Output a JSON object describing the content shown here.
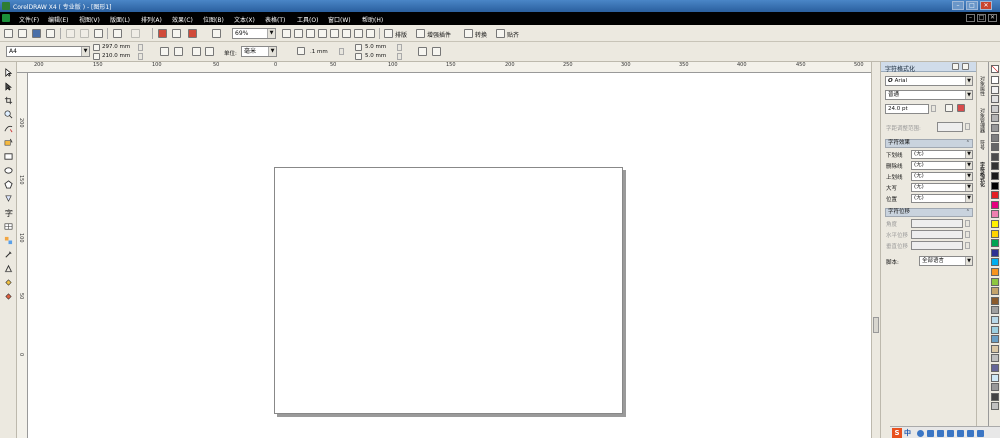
{
  "window": {
    "title": "CorelDRAW X4 ( 专业版 ) - [图形1]",
    "buttons": [
      "–",
      "□",
      "✕"
    ]
  },
  "menu": {
    "items": [
      "文件(F)",
      "编辑(E)",
      "视图(V)",
      "版面(L)",
      "排列(A)",
      "效果(C)",
      "位图(B)",
      "文本(X)",
      "表格(T)",
      "工具(O)",
      "窗口(W)",
      "帮助(H)"
    ]
  },
  "toolbar": {
    "zoom": "69%",
    "buttons": [
      "排版",
      "增强插件",
      "转换",
      "贴齐"
    ]
  },
  "propbar": {
    "paper": "A4",
    "width": "297.0 mm",
    "height": "210.0 mm",
    "unit_label": "单位:",
    "unit": "毫米",
    "nudge": ".1 mm",
    "dup_x": "5.0 mm",
    "dup_y": "5.0 mm"
  },
  "ruler": {
    "top_labels": [
      "200",
      "150",
      "100",
      "50",
      "0",
      "50",
      "100",
      "150",
      "200",
      "250",
      "300",
      "350",
      "400",
      "450",
      "500"
    ],
    "side_labels": [
      "200",
      "150",
      "100",
      "50",
      "0"
    ]
  },
  "docker": {
    "title": "字符格式化",
    "font": "Arial",
    "style": "普通",
    "size": "24.0 pt",
    "kerning_label": "字距调整范围:",
    "effects_header": "字符效果",
    "effects": [
      {
        "label": "下划线",
        "value": "(无)"
      },
      {
        "label": "删除线",
        "value": "(无)"
      },
      {
        "label": "上划线",
        "value": "(无)"
      },
      {
        "label": "大写",
        "value": "(无)"
      },
      {
        "label": "位置",
        "value": "(无)"
      }
    ],
    "shift_header": "字符位移",
    "shift": [
      "角度",
      "水平位移",
      "垂直位移"
    ],
    "script_label": "脚本:",
    "script": "全部语言"
  },
  "sidetabs": [
    "对象属性",
    "对象管理器",
    "符号",
    "字符格式化"
  ],
  "palette": {
    "colors": [
      "#ffffff",
      "#f2f2f2",
      "#e0e0e0",
      "#cccccc",
      "#b3b3b3",
      "#999999",
      "#7f7f7f",
      "#666666",
      "#4d4d4d",
      "#333333",
      "#1a1a1a",
      "#000000",
      "#e31e24",
      "#e6007e",
      "#ef7fb0",
      "#fff200",
      "#ffd400",
      "#00a651",
      "#2e3192",
      "#00aeef",
      "#f7941d",
      "#8dc63f",
      "#c4a36a",
      "#8b5a2b",
      "#a0a0a0",
      "#b8d8e8",
      "#9ccfe0",
      "#6a9fc4",
      "#d9c7a6",
      "#bdbdbd",
      "#666699",
      "#cfe8f5",
      "#999999",
      "#444444",
      "#c0c0c0"
    ]
  },
  "tray": {
    "ime": "S",
    "lang": "中"
  }
}
